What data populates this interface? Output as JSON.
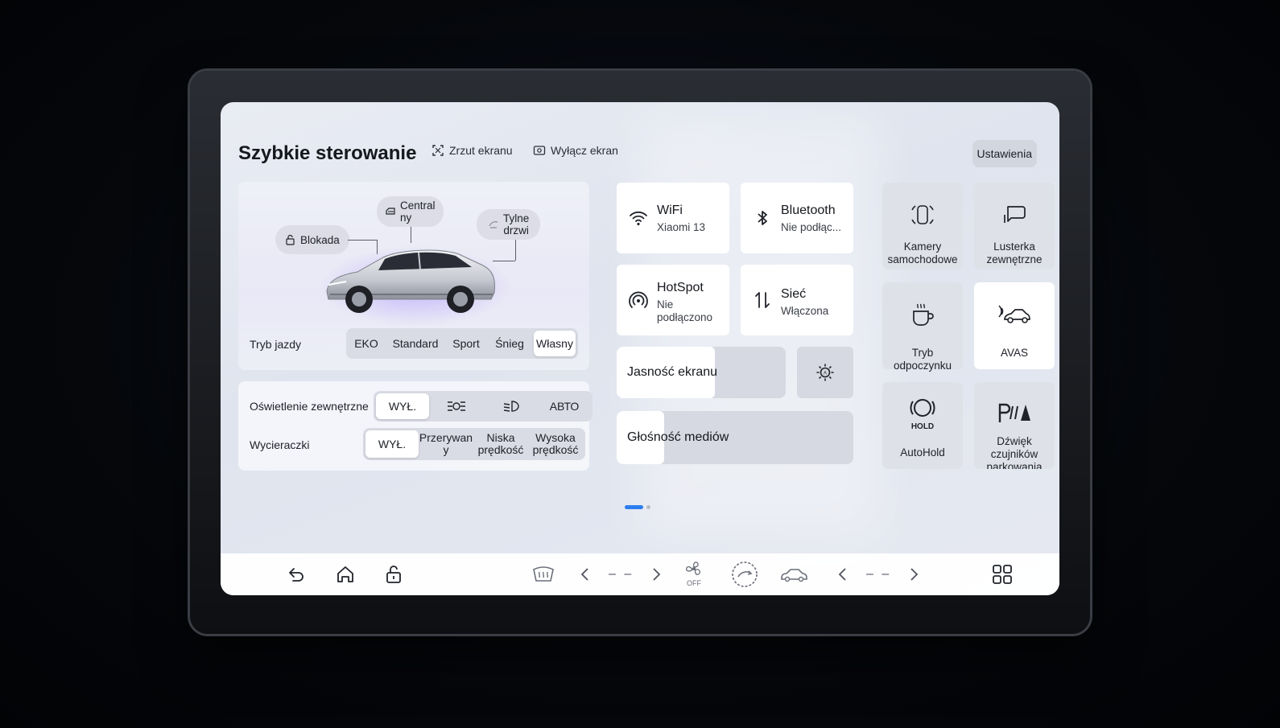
{
  "header": {
    "title": "Szybkie sterowanie",
    "screenshot_label": "Zrzut ekranu",
    "screen_off_label": "Wyłącz ekran",
    "settings_label": "Ustawienia"
  },
  "car": {
    "lock_label": "Blokada",
    "central_label_1": "Central",
    "central_label_2": "ny",
    "rear_doors_label_1": "Tylne",
    "rear_doors_label_2": "drzwi",
    "drive_mode_label": "Tryb jazdy",
    "drive_modes": [
      "EKO",
      "Standard",
      "Sport",
      "Śnieg",
      "Własny"
    ],
    "drive_mode_selected": "Własny"
  },
  "lighting": {
    "label": "Oświetlenie zewnętrzne",
    "options": [
      "WYŁ.",
      "position-lights-icon",
      "low-beam-icon",
      "АВТО"
    ],
    "off_label": "WYŁ.",
    "auto_label": "АВТО",
    "selected": "WYŁ."
  },
  "wipers": {
    "label": "Wycieraczki",
    "off_label": "WYŁ.",
    "intermittent_1": "Przerywan",
    "intermittent_2": "y",
    "low_1": "Niska",
    "low_2": "prędkość",
    "high_1": "Wysoka",
    "high_2": "prędkość",
    "selected": "WYŁ."
  },
  "connectivity": {
    "wifi_title": "WiFi",
    "wifi_sub": "Xiaomi 13",
    "bt_title": "Bluetooth",
    "bt_sub": "Nie podłąc...",
    "hotspot_title": "HotSpot",
    "hotspot_sub_1": "Nie",
    "hotspot_sub_2": "podłączono",
    "net_title": "Sieć",
    "net_sub": "Włączona"
  },
  "sliders": {
    "brightness_label": "Jasność ekranu",
    "brightness_level": 0.58,
    "volume_label": "Głośność mediów",
    "volume_level": 0.2
  },
  "shortcuts": {
    "cameras_1": "Kamery",
    "cameras_2": "samochodowe",
    "mirrors_1": "Lusterka",
    "mirrors_2": "zewnętrzne",
    "rest_mode": "Tryb odpoczynku",
    "avas": "AVAS",
    "autohold": "AutoHold",
    "autohold_icon_text": "HOLD",
    "parking_1": "Dźwięk",
    "parking_2": "czujników",
    "parking_3": "parkowania"
  },
  "dock": {
    "left_temp": "– –",
    "right_temp": "– –",
    "fan_off": "OFF"
  },
  "colors": {
    "accent": "#2d7df0",
    "tile_bg": "#ffffff",
    "tile_muted": "#dfe1e8"
  }
}
